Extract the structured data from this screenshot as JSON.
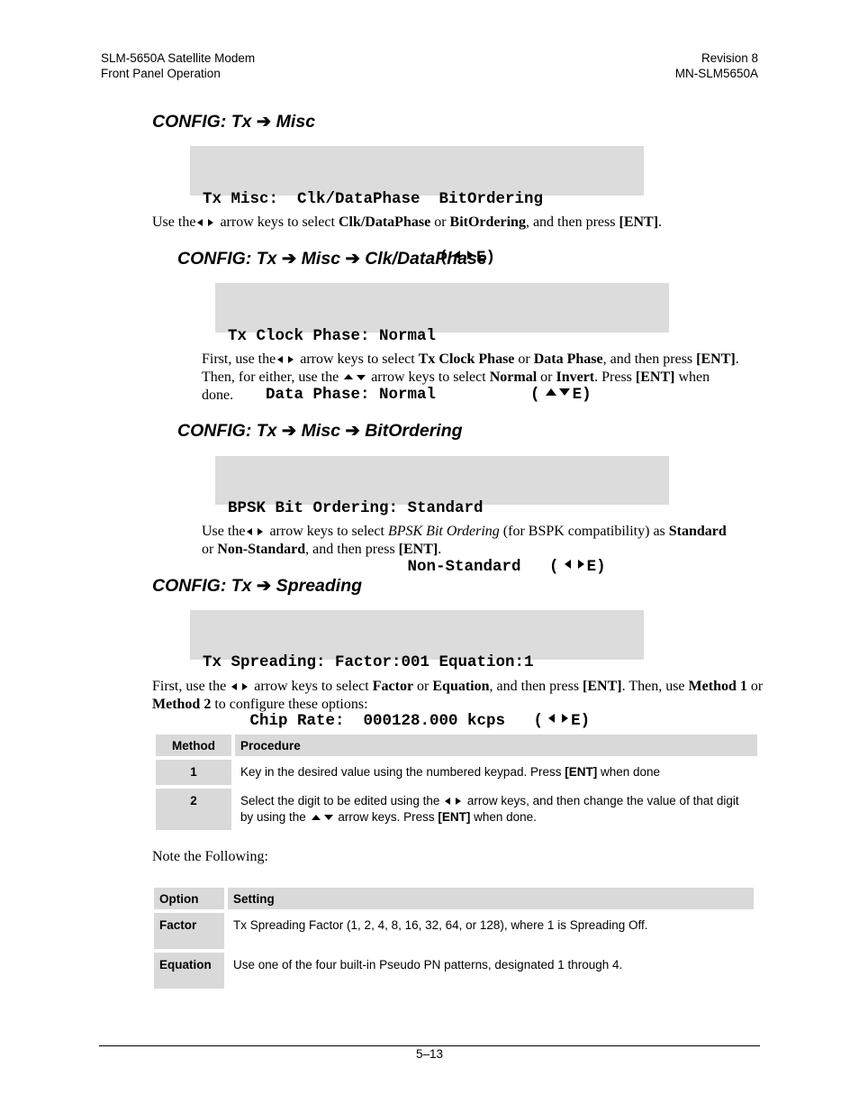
{
  "header": {
    "left_line1": "SLM-5650A Satellite Modem",
    "left_line2": "Front Panel Operation",
    "right_line1": "Revision 8",
    "right_line2": "MN-SLM5650A"
  },
  "sections": {
    "misc": {
      "heading_a": "CONFIG: Tx ",
      "heading_b": " Misc",
      "lcd_line1": "Tx Misc:  Clk/DataPhase  BitOrdering",
      "lcd_line2_pre": "                         (",
      "lcd_line2_post": "E)",
      "para_1": "Use the",
      "para_2": " arrow keys to select ",
      "para_b1": "Clk/DataPhase",
      "para_3": " or ",
      "para_b2": "BitOrdering",
      "para_4": ", and then press ",
      "para_b3": "[ENT]",
      "para_5": "."
    },
    "clkdata": {
      "heading_a": "CONFIG: Tx ",
      "heading_b": " Misc ",
      "heading_c": " Clk/DataPhase",
      "lcd_line1": "Tx Clock Phase: Normal",
      "lcd_line2_pre": "    Data Phase: Normal          (",
      "lcd_line2_post": "E)",
      "p1": "First, use the",
      "p2": " arrow keys to select ",
      "b1": "Tx Clock Phase",
      "p3": " or ",
      "b2": "Data Phase",
      "p4": ", and then press ",
      "b3": "[ENT]",
      "p5": ". Then, for either, use the ",
      "p6": " arrow keys to select ",
      "b4": "Normal",
      "p7": " or ",
      "b5": "Invert",
      "p8": ". Press ",
      "b6": "[ENT]",
      "p9": " when done."
    },
    "bitorder": {
      "heading_a": "CONFIG: Tx ",
      "heading_b": " Misc ",
      "heading_c": " BitOrdering",
      "lcd_line1": "BPSK Bit Ordering: Standard",
      "lcd_line2_pre": "                   Non-Standard   (",
      "lcd_line2_post": "E)",
      "p1": "Use the",
      "p2": " arrow keys to select ",
      "i1": "BPSK Bit Ordering",
      "p3": " (for BSPK compatibility) as ",
      "b1": "Standard",
      "p4": " or ",
      "b2": "Non-Standard",
      "p5": ", and then press ",
      "b3": "[ENT]",
      "p6": "."
    },
    "spreading": {
      "heading_a": "CONFIG: Tx ",
      "heading_b": " Spreading",
      "lcd_line1": "Tx Spreading: Factor:001 Equation:1",
      "lcd_line2_pre": "     Chip Rate:  000128.000 kcps   (",
      "lcd_line2_post": "E)",
      "p1": "First, use the ",
      "p2": " arrow keys to select ",
      "b1": "Factor",
      "p3": " or ",
      "b2": "Equation",
      "p4": ", and then press ",
      "b3": "[ENT]",
      "p5": ". Then, use ",
      "b4": "Method 1",
      "p6": " or ",
      "b5": "Method 2",
      "p7": " to configure these options:"
    }
  },
  "method_table": {
    "headers": [
      "Method",
      "Procedure"
    ],
    "rows": [
      {
        "key": "1",
        "text_a": "Key in the desired value using the numbered keypad. Press ",
        "text_b": "[ENT]",
        "text_c": " when done"
      },
      {
        "key": "2",
        "text_a": "Select the digit to be edited using the ",
        "text_b": " arrow keys, and then change the value of that digit by using the ",
        "text_c": " arrow keys. Press ",
        "text_d": "[ENT]",
        "text_e": " when done."
      }
    ]
  },
  "note": "Note the Following:",
  "option_table": {
    "headers": [
      "Option",
      "Setting"
    ],
    "rows": [
      {
        "key": "Factor",
        "value": "Tx Spreading Factor (1, 2, 4, 8, 16, 32, 64, or 128), where 1 is Spreading Off."
      },
      {
        "key": "Equation",
        "value": "Use one of the four built-in Pseudo PN patterns, designated 1 through 4."
      }
    ]
  },
  "footer": {
    "page": "5–13"
  },
  "icons": {
    "arrow": "right-arrow-icon",
    "left": "left-triangle-icon",
    "right": "right-triangle-icon",
    "up": "up-triangle-icon",
    "down": "down-triangle-icon"
  }
}
